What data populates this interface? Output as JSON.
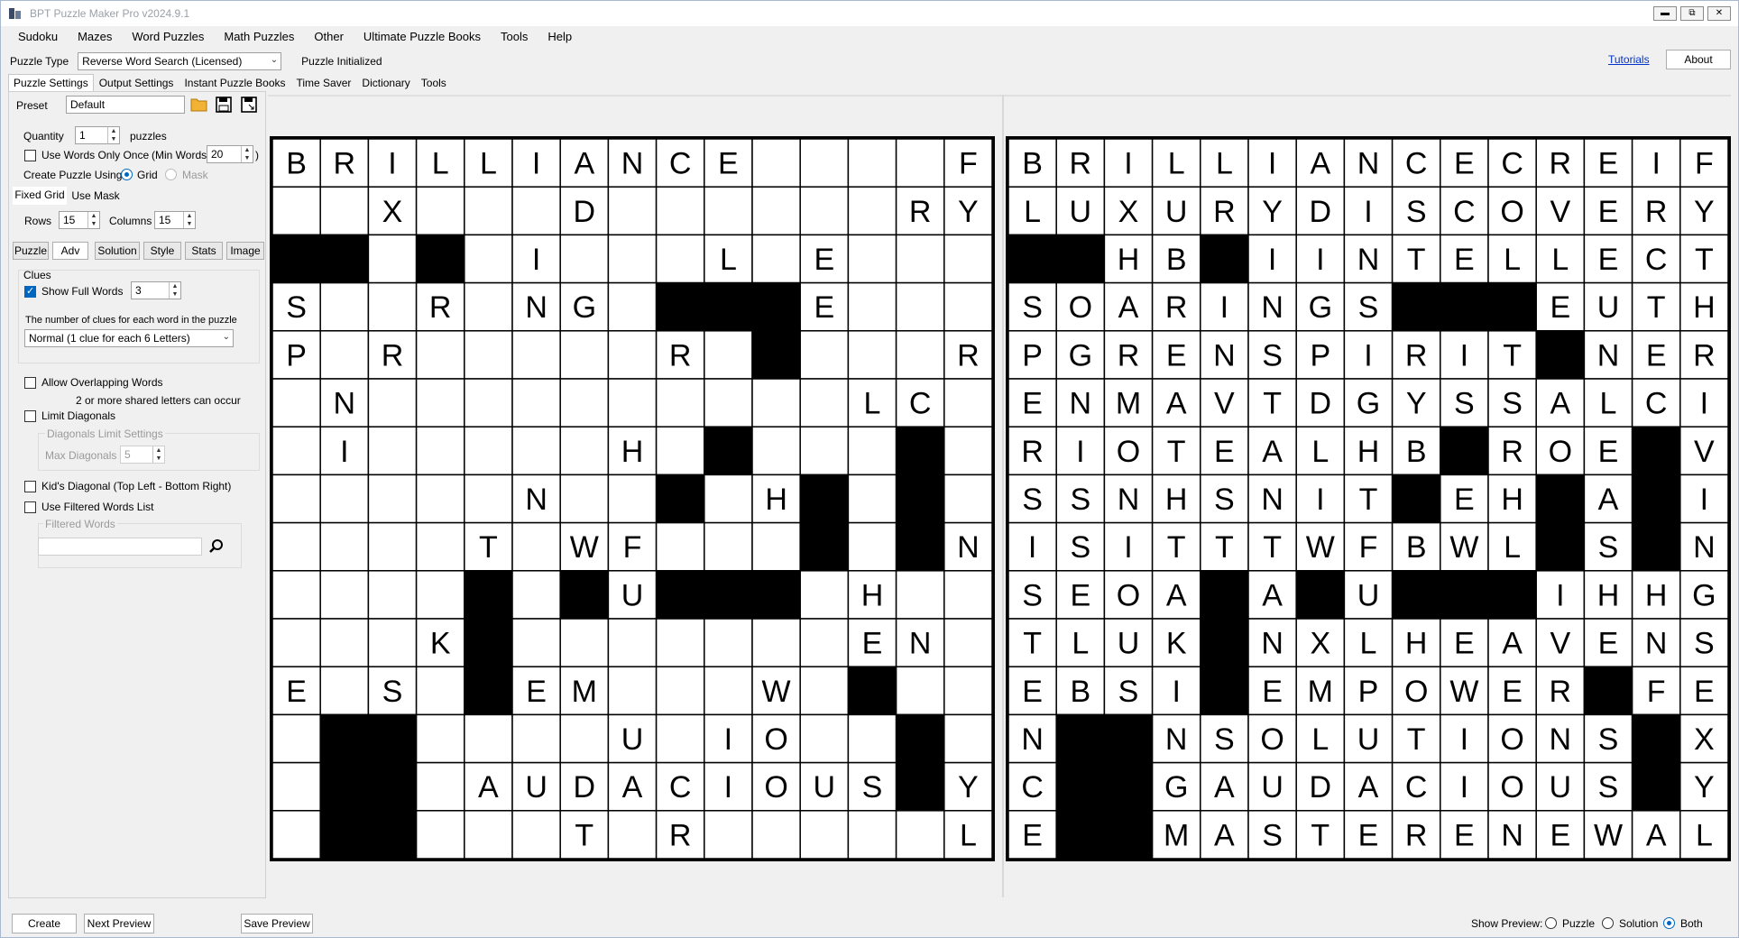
{
  "window": {
    "title": "BPT Puzzle Maker Pro v2024.9.1"
  },
  "menu": [
    "Sudoku",
    "Mazes",
    "Word Puzzles",
    "Math Puzzles",
    "Other",
    "Ultimate Puzzle Books",
    "Tools",
    "Help"
  ],
  "puzzle_type": {
    "label": "Puzzle Type",
    "value": "Reverse Word Search (Licensed)",
    "status": "Puzzle Initialized"
  },
  "header_links": {
    "tutorials": "Tutorials",
    "about": "About"
  },
  "main_tabs": [
    "Puzzle Settings",
    "Output Settings",
    "Instant Puzzle Books",
    "Time Saver",
    "Dictionary",
    "Tools"
  ],
  "settings": {
    "preset_label": "Preset",
    "preset_value": "Default",
    "quantity_label": "Quantity",
    "quantity_value": "1",
    "quantity_unit": "puzzles",
    "use_words_once": "Use Words Only Once",
    "min_words_label": "(Min Words:",
    "min_words_value": "20",
    "min_words_close": ")",
    "create_using": "Create Puzzle Using:",
    "grid_option": "Grid",
    "mask_option": "Mask",
    "fixed_grid_tab": "Fixed Grid",
    "use_mask_tab": "Use Mask",
    "rows_label": "Rows",
    "rows_value": "15",
    "cols_label": "Columns",
    "cols_value": "15",
    "sub_tabs": [
      "Puzzle",
      "Adv",
      "Solution",
      "Style",
      "Stats",
      "Image"
    ],
    "clues_group": "Clues",
    "show_full_words": "Show Full Words",
    "show_full_words_value": "3",
    "clues_desc": "The number of clues for each word in the puzzle",
    "clues_select": "Normal (1 clue for each 6 Letters)",
    "allow_overlap": "Allow Overlapping Words",
    "overlap_note": "2 or more shared letters can occur",
    "limit_diag": "Limit Diagonals",
    "diag_group": "Diagonals Limit Settings",
    "max_diag_label": "Max Diagonals",
    "max_diag_value": "5",
    "kids_diag": "Kid's Diagonal (Top Left - Bottom Right)",
    "filtered_list": "Use Filtered Words List",
    "filtered_group": "Filtered Words"
  },
  "puzzle_grid": {
    "rows": [
      "BRILLIANCE....F",
      "..X...D......RY",
      "##.#.I...L.E...",
      "S..R.NG.###E...",
      "P.R.....R.#...R",
      ".N..........LC.",
      ".I.....H.#...#.",
      ".....N..#.H#.#.",
      "....T.WF...#.#N",
      "....#.#U###.H..",
      "...K#.......EN.",
      "E.S.#EM...W.#..",
      ".##....U.IO..#.",
      ".##.AUDACIOUS#Y",
      ".##...T.R.....L"
    ]
  },
  "solution_grid": {
    "rows": [
      "BRILLIANCECREIF",
      "LUXURYDISCOVERY",
      "##HB#IINTELLECT",
      "SOARINGS###EUTH",
      "PGRENSPIRIT#NER",
      "ENMAVTDGYSSALCI",
      "RIOTEALHB#ROE#V",
      "SSNHSNIT#EH#A#I",
      "ISITTTWFBWL#S#N",
      "SEOA#A#U###IHHG",
      "TLUK#NXLHEAVENS",
      "EBSI#EMPOWER#FE",
      "N##NSOLUTIONS#X",
      "C##GAUDACIOUS#Y",
      "E##MASTERENEWAL"
    ]
  },
  "bottom": {
    "create": "Create",
    "next_preview": "Next Preview",
    "save_preview": "Save Preview",
    "show_preview": "Show Preview:",
    "opt_puzzle": "Puzzle",
    "opt_solution": "Solution",
    "opt_both": "Both"
  },
  "colors": {
    "accent": "#0067c0",
    "link": "#0033cc",
    "black_cell": "#000000"
  }
}
